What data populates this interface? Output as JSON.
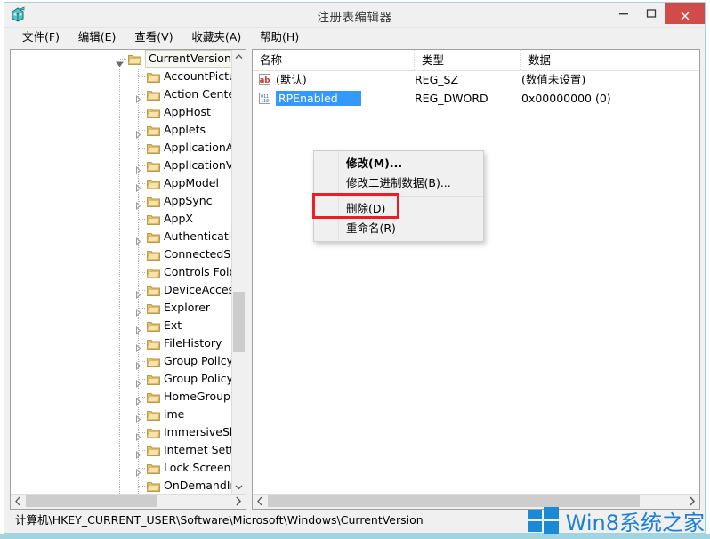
{
  "window": {
    "title": "注册表编辑器",
    "app_icon": "registry-editor-icon",
    "minimize_label": "最小化",
    "maximize_label": "最大化",
    "close_label": "关闭"
  },
  "menubar": {
    "items": [
      {
        "label": "文件(F)",
        "name": "menu-file"
      },
      {
        "label": "编辑(E)",
        "name": "menu-edit"
      },
      {
        "label": "查看(V)",
        "name": "menu-view"
      },
      {
        "label": "收藏夹(A)",
        "name": "menu-favorites"
      },
      {
        "label": "帮助(H)",
        "name": "menu-help"
      }
    ]
  },
  "tree": {
    "items": [
      {
        "label": "CurrentVersion",
        "depth": 0,
        "expandable": true,
        "expanded": true,
        "selected": true
      },
      {
        "label": "AccountPicture",
        "depth": 1,
        "expandable": false,
        "expanded": false,
        "selected": false
      },
      {
        "label": "Action Center",
        "depth": 1,
        "expandable": true,
        "expanded": false,
        "selected": false
      },
      {
        "label": "AppHost",
        "depth": 1,
        "expandable": false,
        "expanded": false,
        "selected": false
      },
      {
        "label": "Applets",
        "depth": 1,
        "expandable": true,
        "expanded": false,
        "selected": false
      },
      {
        "label": "ApplicationAss",
        "depth": 1,
        "expandable": false,
        "expanded": false,
        "selected": false
      },
      {
        "label": "ApplicationVie",
        "depth": 1,
        "expandable": true,
        "expanded": false,
        "selected": false
      },
      {
        "label": "AppModel",
        "depth": 1,
        "expandable": true,
        "expanded": false,
        "selected": false
      },
      {
        "label": "AppSync",
        "depth": 1,
        "expandable": true,
        "expanded": false,
        "selected": false
      },
      {
        "label": "AppX",
        "depth": 1,
        "expandable": false,
        "expanded": false,
        "selected": false
      },
      {
        "label": "Authentication",
        "depth": 1,
        "expandable": true,
        "expanded": false,
        "selected": false
      },
      {
        "label": "ConnectedSear",
        "depth": 1,
        "expandable": false,
        "expanded": false,
        "selected": false
      },
      {
        "label": "Controls Folde",
        "depth": 1,
        "expandable": false,
        "expanded": false,
        "selected": false
      },
      {
        "label": "DeviceAccess",
        "depth": 1,
        "expandable": true,
        "expanded": false,
        "selected": false
      },
      {
        "label": "Explorer",
        "depth": 1,
        "expandable": true,
        "expanded": false,
        "selected": false
      },
      {
        "label": "Ext",
        "depth": 1,
        "expandable": true,
        "expanded": false,
        "selected": false
      },
      {
        "label": "FileHistory",
        "depth": 1,
        "expandable": true,
        "expanded": false,
        "selected": false
      },
      {
        "label": "Group Policy",
        "depth": 1,
        "expandable": true,
        "expanded": false,
        "selected": false
      },
      {
        "label": "Group Policy E",
        "depth": 1,
        "expandable": true,
        "expanded": false,
        "selected": false
      },
      {
        "label": "HomeGroup",
        "depth": 1,
        "expandable": true,
        "expanded": false,
        "selected": false
      },
      {
        "label": "ime",
        "depth": 1,
        "expandable": true,
        "expanded": false,
        "selected": false
      },
      {
        "label": "ImmersiveShel",
        "depth": 1,
        "expandable": true,
        "expanded": false,
        "selected": false
      },
      {
        "label": "Internet Setting",
        "depth": 1,
        "expandable": true,
        "expanded": false,
        "selected": false
      },
      {
        "label": "Lock Screen",
        "depth": 1,
        "expandable": true,
        "expanded": false,
        "selected": false
      },
      {
        "label": "OnDemandInte",
        "depth": 1,
        "expandable": false,
        "expanded": false,
        "selected": false
      }
    ]
  },
  "list": {
    "columns": [
      {
        "label": "名称",
        "name": "column-name"
      },
      {
        "label": "类型",
        "name": "column-type"
      },
      {
        "label": "数据",
        "name": "column-data"
      }
    ],
    "rows": [
      {
        "icon": "string-value-icon",
        "name": "(默认)",
        "type": "REG_SZ",
        "data": "(数值未设置)",
        "selected": false
      },
      {
        "icon": "dword-value-icon",
        "name": "RPEnabled",
        "type": "REG_DWORD",
        "data": "0x00000000 (0)",
        "selected": true
      }
    ]
  },
  "context_menu": {
    "items": [
      {
        "label": "修改(M)...",
        "name": "ctx-modify",
        "bold": true,
        "separator_after": false
      },
      {
        "label": "修改二进制数据(B)...",
        "name": "ctx-modify-binary",
        "bold": false,
        "separator_after": true
      },
      {
        "label": "删除(D)",
        "name": "ctx-delete",
        "bold": false,
        "separator_after": false
      },
      {
        "label": "重命名(R)",
        "name": "ctx-rename",
        "bold": false,
        "separator_after": false
      }
    ],
    "highlight_target": "删除(D)",
    "highlight_color": "#ee1c24"
  },
  "statusbar": {
    "path": "计算机\\HKEY_CURRENT_USER\\Software\\Microsoft\\Windows\\CurrentVersion"
  },
  "watermark": {
    "text": "Win8系统之家",
    "logo": "windows-logo-icon",
    "color": "#1b7fd4"
  },
  "colors": {
    "selection_blue": "#3399ff",
    "close_red": "#d14b4b",
    "frame_cyan": "#9fd4e0",
    "folder_yellow": "#e8c977"
  }
}
